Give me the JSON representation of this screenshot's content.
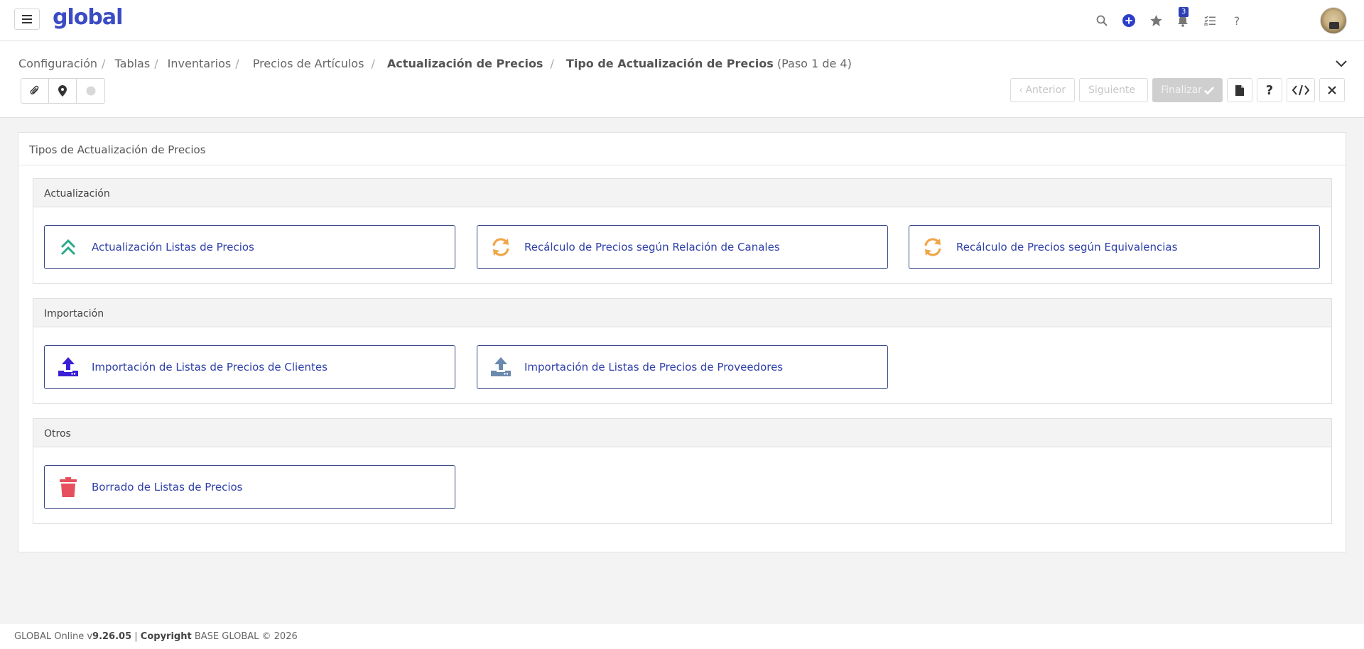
{
  "topbar": {
    "logo": "global",
    "notifications_count": "3",
    "icons": [
      "menu-icon",
      "search-icon",
      "add-icon",
      "star-icon",
      "bell-icon",
      "tasks-icon",
      "help-icon"
    ]
  },
  "breadcrumb": {
    "items": [
      "Configuración",
      "Tablas",
      "Inventarios",
      "Precios de Artículos"
    ],
    "current_parent": "Actualización de Precios",
    "current": "Tipo de Actualización de Precios",
    "step": "(Paso 1 de 4)"
  },
  "toolbar": {
    "prev_label": "Anterior",
    "next_label": "Siguiente",
    "finish_label": "Finalizar"
  },
  "card": {
    "title": "Tipos de Actualización de Precios",
    "sections": [
      {
        "title": "Actualización",
        "options": [
          {
            "label": "Actualización Listas de Precios",
            "icon": "double-chevron-up-icon",
            "color": "#2aa889"
          },
          {
            "label": "Recálculo de Precios según Relación de Canales",
            "icon": "sync-icon",
            "color": "#f0a64a"
          },
          {
            "label": "Recálculo de Precios según Equivalencias",
            "icon": "sync-icon",
            "color": "#f0a64a"
          }
        ]
      },
      {
        "title": "Importación",
        "options": [
          {
            "label": "Importación de Listas de Precios de Clientes",
            "icon": "upload-icon",
            "color": "#3a1fd6"
          },
          {
            "label": "Importación de Listas de Precios de Proveedores",
            "icon": "upload-icon",
            "color": "#6a8aae"
          }
        ]
      },
      {
        "title": "Otros",
        "options": [
          {
            "label": "Borrado de Listas de Precios",
            "icon": "trash-icon",
            "color": "#e5505c"
          }
        ]
      }
    ]
  },
  "footer": {
    "prefix": "GLOBAL Online v",
    "version": "9.26.05",
    "separator": " | ",
    "copyright_label": "Copyright",
    "copyright_text": " BASE GLOBAL © 2026"
  }
}
